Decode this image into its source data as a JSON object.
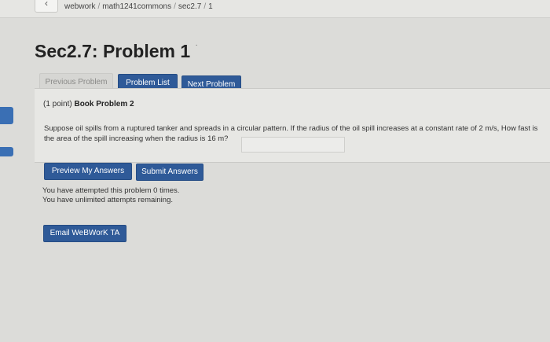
{
  "header": {
    "back_label": "‹",
    "breadcrumb": [
      "webwork",
      "math1241commons",
      "sec2.7",
      "1"
    ],
    "separator": "/"
  },
  "page": {
    "title": "Sec2.7: Problem 1",
    "title_suffix": "·"
  },
  "nav": {
    "previous_label": "Previous Problem",
    "list_label": "Problem List",
    "next_label": "Next Problem"
  },
  "problem": {
    "points": "(1 point)",
    "name": "Book Problem 2",
    "text_line1": "Suppose oil spills from a ruptured tanker and spreads in a circular pattern. If the radius of the oil spill increases at a constant rate of 2 m/s, How fast is",
    "text_line2": "the area of the spill increasing when the radius is 16 m?",
    "answer_value": ""
  },
  "actions": {
    "preview_label": "Preview My Answers",
    "submit_label": "Submit Answers",
    "email_label": "Email WeBWorK TA"
  },
  "status": {
    "attempts_line1": "You have attempted this problem 0 times.",
    "attempts_line2": "You have unlimited attempts remaining."
  },
  "colors": {
    "accent": "#2f5a98",
    "background": "#dcdcd9"
  }
}
